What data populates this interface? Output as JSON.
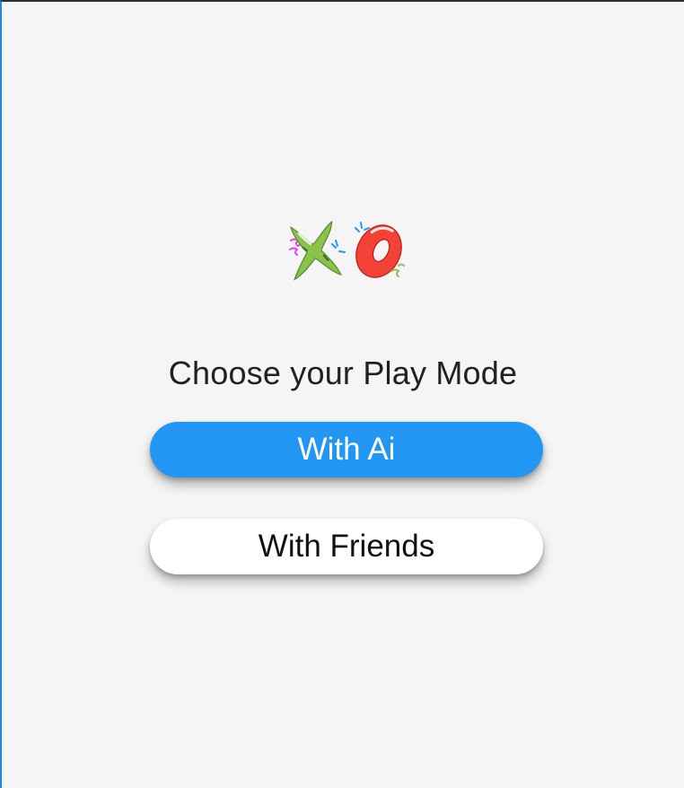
{
  "logo": {
    "icon": "xo-logo-icon",
    "x_color": "#8bc34a",
    "o_color": "#f44336"
  },
  "title": "Choose your Play Mode",
  "buttons": {
    "with_ai": {
      "label": "With Ai",
      "color": "#2196f3"
    },
    "with_friends": {
      "label": "With Friends",
      "color": "#ffffff"
    }
  }
}
